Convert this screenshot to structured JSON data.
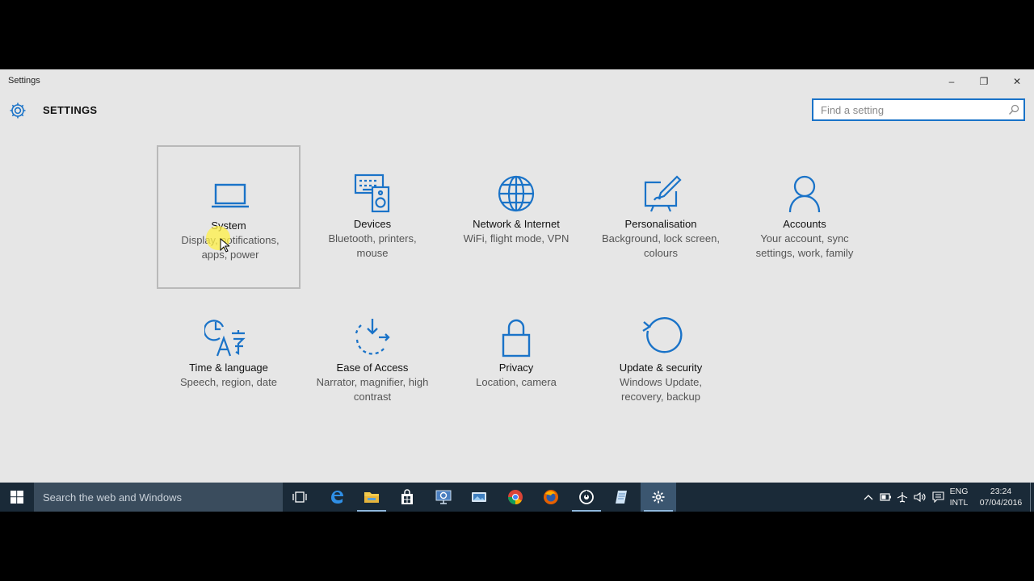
{
  "window": {
    "title": "Settings",
    "controls": {
      "minimize": "–",
      "maximize": "❐",
      "close": "✕"
    }
  },
  "header": {
    "title": "SETTINGS"
  },
  "search": {
    "placeholder": "Find a setting"
  },
  "tiles": [
    {
      "name": "System",
      "desc": "Display, notifications, apps, power",
      "icon": "laptop-icon",
      "selected": true
    },
    {
      "name": "Devices",
      "desc": "Bluetooth, printers, mouse",
      "icon": "devices-icon"
    },
    {
      "name": "Network & Internet",
      "desc": "WiFi, flight mode, VPN",
      "icon": "globe-icon"
    },
    {
      "name": "Personalisation",
      "desc": "Background, lock screen, colours",
      "icon": "paint-icon"
    },
    {
      "name": "Accounts",
      "desc": "Your account, sync settings, work, family",
      "icon": "person-icon"
    },
    {
      "name": "Time & language",
      "desc": "Speech, region, date",
      "icon": "time-language-icon"
    },
    {
      "name": "Ease of Access",
      "desc": "Narrator, magnifier, high contrast",
      "icon": "ease-of-access-icon"
    },
    {
      "name": "Privacy",
      "desc": "Location, camera",
      "icon": "lock-icon"
    },
    {
      "name": "Update & security",
      "desc": "Windows Update, recovery, backup",
      "icon": "refresh-icon"
    }
  ],
  "taskbar": {
    "search_placeholder": "Search the web and Windows",
    "apps": [
      "task-view",
      "edge",
      "file-explorer",
      "store",
      "remote-desktop",
      "photos",
      "chrome",
      "firefox",
      "groove",
      "notepad",
      "settings"
    ],
    "language_line1": "ENG",
    "language_line2": "INTL",
    "time": "23:24",
    "date": "07/04/2016"
  },
  "colors": {
    "accent": "#1a73c8",
    "window_bg": "#e6e6e6",
    "taskbar_bg": "#1a2a38"
  }
}
